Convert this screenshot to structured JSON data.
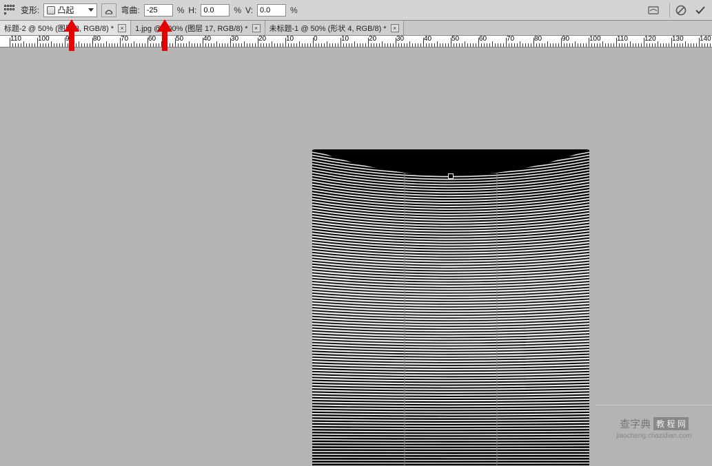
{
  "options": {
    "warp_label": "变形:",
    "warp_preset": "凸起",
    "bend_label": "弯曲:",
    "bend_value": "-25",
    "h_label": "H:",
    "h_value": "0.0",
    "v_label": "V:",
    "v_value": "0.0",
    "pct": "%"
  },
  "tabs": [
    {
      "label": "标题-2 @ 50% (图层 3, RGB/8) *",
      "active": true
    },
    {
      "label": "1.jpg @ 100% (图层 17, RGB/8) *",
      "active": false
    },
    {
      "label": "未标题-1 @ 50% (形状 4, RGB/8) *",
      "active": false
    }
  ],
  "ruler": {
    "labels": [
      "110",
      "100",
      "90",
      "80",
      "70",
      "60",
      "50",
      "40",
      "30",
      "20",
      "10",
      "0",
      "10",
      "20",
      "30",
      "40",
      "50",
      "60",
      "70",
      "80",
      "90",
      "100",
      "110",
      "120",
      "130",
      "140"
    ]
  },
  "icons": {
    "close_x": "×"
  },
  "watermark": {
    "main": "查字典",
    "badge": "教 程 网",
    "sub": "jiaocheng.chazidian.com"
  }
}
